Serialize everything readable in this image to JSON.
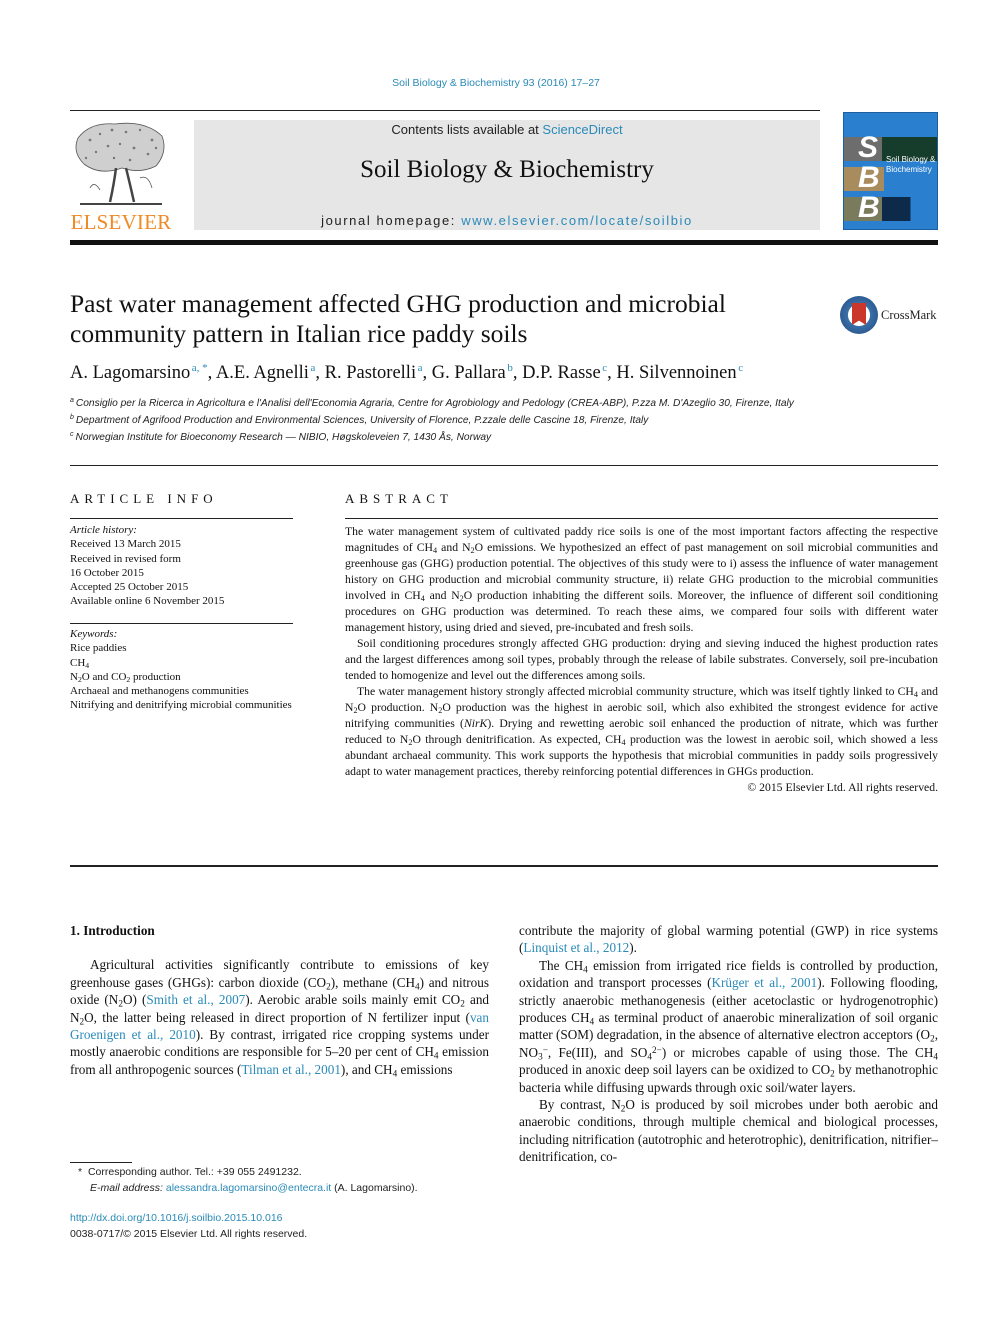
{
  "header": {
    "citation": "Soil Biology & Biochemistry 93 (2016) 17–27",
    "contents_prefix": "Contents lists available at ",
    "contents_link": "ScienceDirect",
    "journal_name": "Soil Biology & Biochemistry",
    "homepage_prefix": "journal homepage: ",
    "homepage_link": "www.elsevier.com/locate/soilbio",
    "publisher_logo_text": "ELSEVIER",
    "cover": {
      "letters": [
        "S",
        "B",
        "B"
      ],
      "title_line1": "Soil Biology &",
      "title_line2": "Biochemistry",
      "color": "#2a7fcf"
    }
  },
  "article": {
    "title": "Past water management affected GHG production and microbial community pattern in Italian rice paddy soils",
    "crossmark_label": "CrossMark",
    "authors": [
      {
        "name": "A. Lagomarsino",
        "sup": "a, *"
      },
      {
        "name": "A.E. Agnelli",
        "sup": "a"
      },
      {
        "name": "R. Pastorelli",
        "sup": "a"
      },
      {
        "name": "G. Pallara",
        "sup": "b"
      },
      {
        "name": "D.P. Rasse",
        "sup": "c"
      },
      {
        "name": "H. Silvennoinen",
        "sup": "c"
      }
    ],
    "affiliations": [
      {
        "mark": "a",
        "text": "Consiglio per la Ricerca in Agricoltura e l'Analisi dell'Economia Agraria, Centre for Agrobiology and Pedology (CREA-ABP), P.zza M. D'Azeglio 30, Firenze, Italy"
      },
      {
        "mark": "b",
        "text": "Department of Agrifood Production and Environmental Sciences, University of Florence, P.zzale delle Cascine 18, Firenze, Italy"
      },
      {
        "mark": "c",
        "text": "Norwegian Institute for Bioeconomy Research — NIBIO, Høgskoleveien 7, 1430 Ås, Norway"
      }
    ]
  },
  "article_info": {
    "heading": "ARTICLE INFO",
    "history_label": "Article history:",
    "history": [
      "Received 13 March 2015",
      "Received in revised form",
      "16 October 2015",
      "Accepted 25 October 2015",
      "Available online 6 November 2015"
    ],
    "keywords_label": "Keywords:",
    "keywords": [
      "Rice paddies",
      "CH4",
      "N2O and CO2 production",
      "Archaeal and methanogens communities",
      "Nitrifying and denitrifying microbial communities"
    ]
  },
  "abstract": {
    "heading": "ABSTRACT",
    "paragraphs": [
      "The water management system of cultivated paddy rice soils is one of the most important factors affecting the respective magnitudes of CH4 and N2O emissions. We hypothesized an effect of past management on soil microbial communities and greenhouse gas (GHG) production potential. The objectives of this study were to i) assess the influence of water management history on GHG production and microbial community structure, ii) relate GHG production to the microbial communities involved in CH4 and N2O production inhabiting the different soils. Moreover, the influence of different soil conditioning procedures on GHG production was determined. To reach these aims, we compared four soils with different water management history, using dried and sieved, pre-incubated and fresh soils.",
      "Soil conditioning procedures strongly affected GHG production: drying and sieving induced the highest production rates and the largest differences among soil types, probably through the release of labile substrates. Conversely, soil pre-incubation tended to homogenize and level out the differences among soils.",
      "The water management history strongly affected microbial community structure, which was itself tightly linked to CH4 and N2O production. N2O production was the highest in aerobic soil, which also exhibited the strongest evidence for active nitrifying communities (NirK). Drying and rewetting aerobic soil enhanced the production of nitrate, which was further reduced to N2O through denitrification. As expected, CH4 production was the lowest in aerobic soil, which showed a less abundant archaeal community. This work supports the hypothesis that microbial communities in paddy soils progressively adapt to water management practices, thereby reinforcing potential differences in GHGs production."
    ],
    "copyright": "© 2015 Elsevier Ltd. All rights reserved."
  },
  "body": {
    "section_heading": "1.  Introduction",
    "left_paragraph": {
      "t1": "Agricultural activities significantly contribute to emissions of key greenhouse gases (GHGs): carbon dioxide (CO",
      "t2": "), methane (CH",
      "t3": ") and nitrous oxide (N",
      "t4": "O) (",
      "cite1": "Smith et al., 2007",
      "t5": "). Aerobic arable soils mainly emit CO",
      "t6": " and N",
      "t7": "O, the latter being released in direct proportion of N fertilizer input (",
      "cite2": "van Groenigen et al., 2010",
      "t8": "). By contrast, irrigated rice cropping systems under mostly anaerobic conditions are responsible for 5–20 per cent of CH",
      "t9": " emission from all anthropogenic sources (",
      "cite3": "Tilman et al., 2001",
      "t10": "), and CH",
      "t11": " emissions"
    },
    "right_p1": {
      "t1": "contribute the majority of global warming potential (GWP) in rice systems (",
      "cite": "Linquist et al., 2012",
      "t2": ")."
    },
    "right_p2": {
      "t1": "The CH",
      "t2": " emission from irrigated rice fields is controlled by production, oxidation and transport processes (",
      "cite": "Krüger et al., 2001",
      "t3": "). Following flooding, strictly anaerobic methanogenesis (either acetoclastic or hydrogenotrophic) produces CH",
      "t4": " as terminal product of anaerobic mineralization of soil organic matter (SOM) degradation, in the absence of alternative electron acceptors (O",
      "t5": ", NO",
      "t6": ", Fe(III), and SO",
      "t7": ") or microbes capable of using those. The CH",
      "t8": " produced in anoxic deep soil layers can be oxidized to CO",
      "t9": " by methanotrophic bacteria while diffusing upwards through oxic soil/water layers."
    },
    "right_p3": {
      "t1": "By contrast, N",
      "t2": "O is produced by soil microbes under both aerobic and anaerobic conditions, through multiple chemical and biological processes, including nitrification (autotrophic and heterotrophic), denitrification, nitrifier–denitrification, co-"
    },
    "sub": {
      "two": "2",
      "four": "4",
      "three": "3",
      "minus": "−",
      "twominus": "2−"
    }
  },
  "footnote": {
    "star": "*",
    "corresponding": "Corresponding author. Tel.: +39 055 2491232.",
    "email_label": "E-mail address:",
    "email": "alessandra.lagomarsino@entecra.it",
    "email_suffix": " (A. Lagomarsino).",
    "doi": "http://dx.doi.org/10.1016/j.soilbio.2015.10.016",
    "issn": "0038-0717/© 2015 Elsevier Ltd. All rights reserved."
  },
  "colors": {
    "link": "#2a8ab8",
    "elsevier_orange": "#f08a24",
    "banner_gray": "#e6e6e6",
    "crossmark_red": "#c9382b"
  }
}
